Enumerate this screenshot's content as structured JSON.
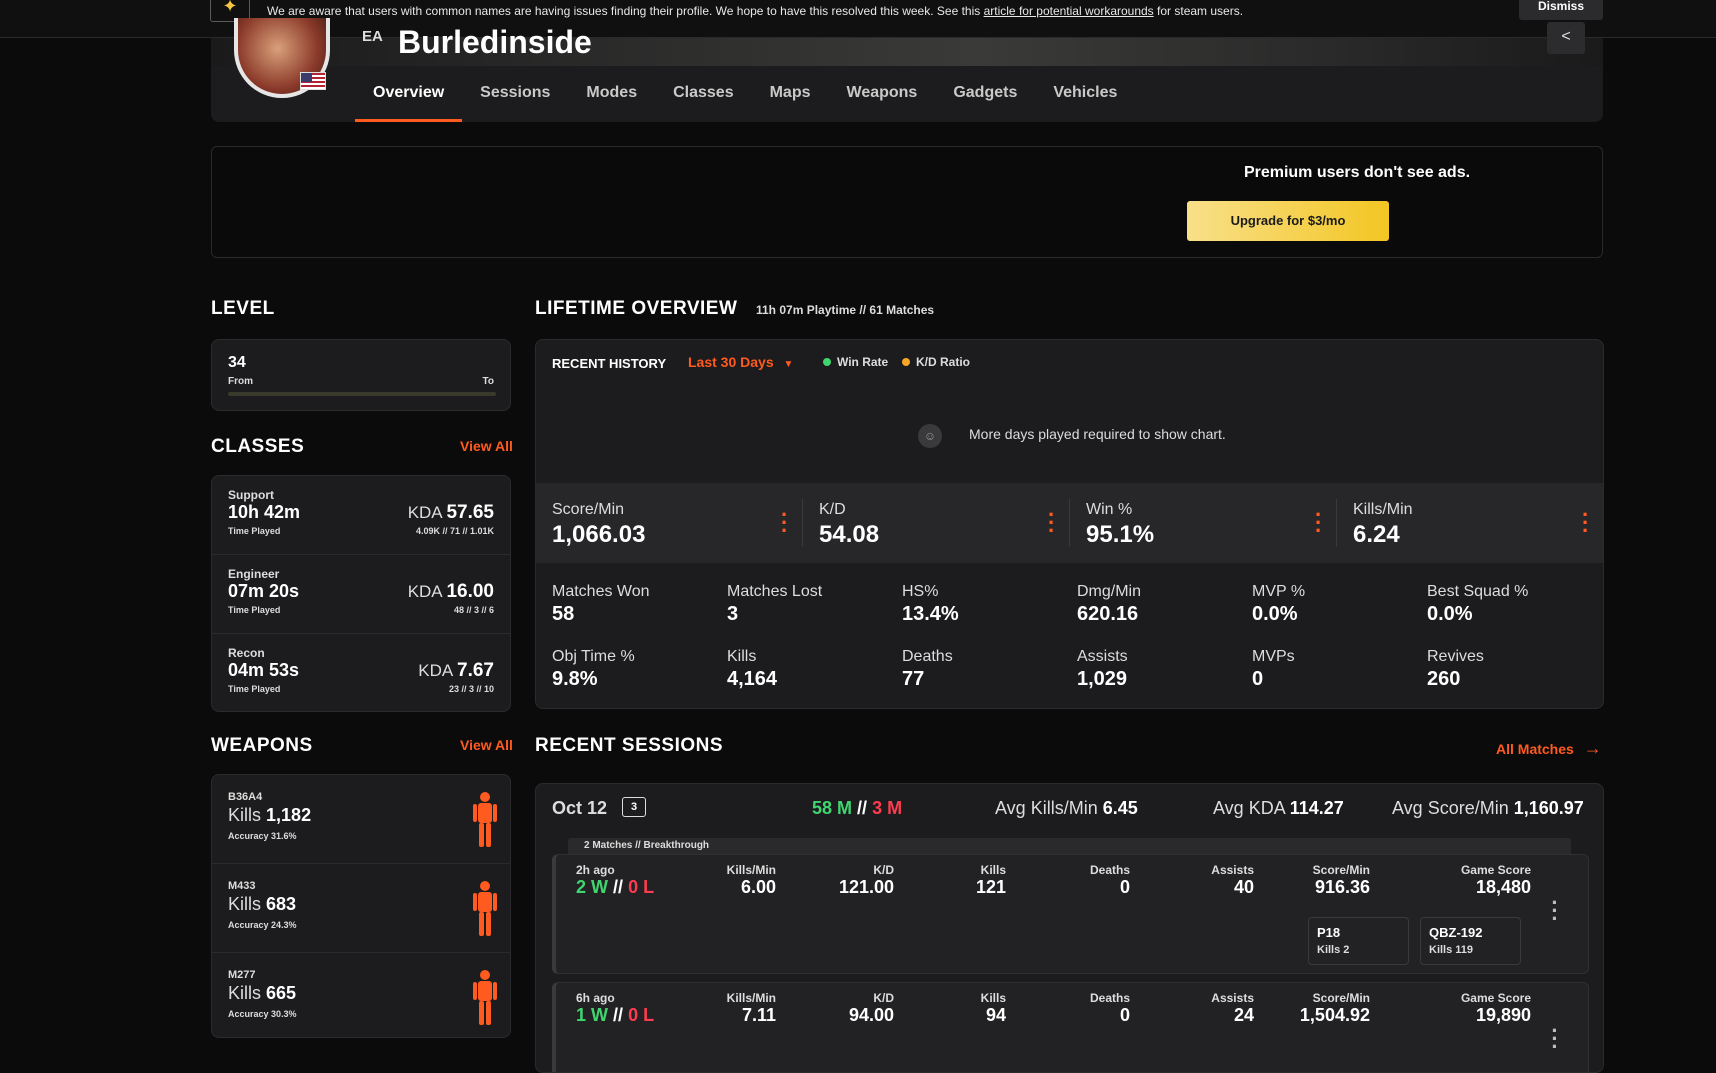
{
  "banner": {
    "message": "We are aware that users with common names are having issues finding their profile. We hope to have this resolved this week. See this ",
    "link": "article for potential workarounds",
    "message_end": " for steam users.",
    "dismiss": "Dismiss"
  },
  "profile": {
    "platform": "EA",
    "name": "Burledinside"
  },
  "tabs": [
    "Overview",
    "Sessions",
    "Modes",
    "Classes",
    "Maps",
    "Weapons",
    "Gadgets",
    "Vehicles"
  ],
  "ad": {
    "text": "Premium users don't see ads.",
    "button": "Upgrade for $3/mo"
  },
  "level": {
    "title": "LEVEL",
    "value": "34",
    "from": "From",
    "to": "To"
  },
  "classes": {
    "title": "CLASSES",
    "view_all": "View All",
    "items": [
      {
        "name": "Support",
        "time": "10h 42m",
        "time_label": "Time Played",
        "kda_label": "KDA",
        "kda": "57.65",
        "kda_sub": "4.09K // 71 // 1.01K"
      },
      {
        "name": "Engineer",
        "time": "07m 20s",
        "time_label": "Time Played",
        "kda_label": "KDA",
        "kda": "16.00",
        "kda_sub": "48 // 3 // 6"
      },
      {
        "name": "Recon",
        "time": "04m 53s",
        "time_label": "Time Played",
        "kda_label": "KDA",
        "kda": "7.67",
        "kda_sub": "23 // 3 // 10"
      }
    ]
  },
  "weapons": {
    "title": "WEAPONS",
    "view_all": "View All",
    "items": [
      {
        "name": "B36A4",
        "kills_label": "Kills",
        "kills": "1,182",
        "accuracy": "Accuracy 31.6%"
      },
      {
        "name": "M433",
        "kills_label": "Kills",
        "kills": "683",
        "accuracy": "Accuracy 24.3%"
      },
      {
        "name": "M277",
        "kills_label": "Kills",
        "kills": "665",
        "accuracy": "Accuracy 30.3%"
      }
    ]
  },
  "lifetime": {
    "title": "LIFETIME OVERVIEW",
    "subtitle": "11h 07m Playtime // 61 Matches",
    "recent_history": "RECENT HISTORY",
    "range": "Last 30 Days",
    "legend": [
      {
        "label": "Win Rate",
        "color": "#3fd66f"
      },
      {
        "label": "K/D Ratio",
        "color": "#f5a623"
      }
    ],
    "no_chart": "More days played required to show chart.",
    "top_stats": [
      {
        "label": "Score/Min",
        "value": "1,066.03"
      },
      {
        "label": "K/D",
        "value": "54.08"
      },
      {
        "label": "Win %",
        "value": "95.1%"
      },
      {
        "label": "Kills/Min",
        "value": "6.24"
      }
    ],
    "grid_stats": [
      {
        "label": "Matches Won",
        "value": "58"
      },
      {
        "label": "Matches Lost",
        "value": "3"
      },
      {
        "label": "HS%",
        "value": "13.4%"
      },
      {
        "label": "Dmg/Min",
        "value": "620.16"
      },
      {
        "label": "MVP %",
        "value": "0.0%"
      },
      {
        "label": "Best Squad %",
        "value": "0.0%"
      },
      {
        "label": "Obj Time %",
        "value": "9.8%"
      },
      {
        "label": "Kills",
        "value": "4,164"
      },
      {
        "label": "Deaths",
        "value": "77"
      },
      {
        "label": "Assists",
        "value": "1,029"
      },
      {
        "label": "MVPs",
        "value": "0"
      },
      {
        "label": "Revives",
        "value": "260"
      }
    ]
  },
  "sessions": {
    "title": "RECENT SESSIONS",
    "all_matches": "All Matches",
    "session": {
      "date": "Oct 12",
      "count": "3",
      "wins": "58 M",
      "sep": "//",
      "losses": "3 M",
      "avg_kpm_label": "Avg Kills/Min",
      "avg_kpm": "6.45",
      "avg_kda_label": "Avg KDA",
      "avg_kda": "114.27",
      "avg_spm_label": "Avg Score/Min",
      "avg_spm": "1,160.97",
      "mode_tag": "2 Matches // Breakthrough"
    },
    "columns": [
      "Kills/Min",
      "K/D",
      "Kills",
      "Deaths",
      "Assists",
      "Score/Min",
      "Game Score"
    ],
    "matches": [
      {
        "ago": "2h ago",
        "w": "2 W",
        "sep": "//",
        "l": "0 L",
        "values": [
          "6.00",
          "121.00",
          "121",
          "0",
          "40",
          "916.36",
          "18,480"
        ],
        "weapons": [
          {
            "name": "P18",
            "kills": "Kills 2"
          },
          {
            "name": "QBZ-192",
            "kills": "Kills 119"
          }
        ]
      },
      {
        "ago": "6h ago",
        "w": "1 W",
        "sep": "//",
        "l": "0 L",
        "values": [
          "7.11",
          "94.00",
          "94",
          "0",
          "24",
          "1,504.92",
          "19,890"
        ]
      }
    ]
  }
}
